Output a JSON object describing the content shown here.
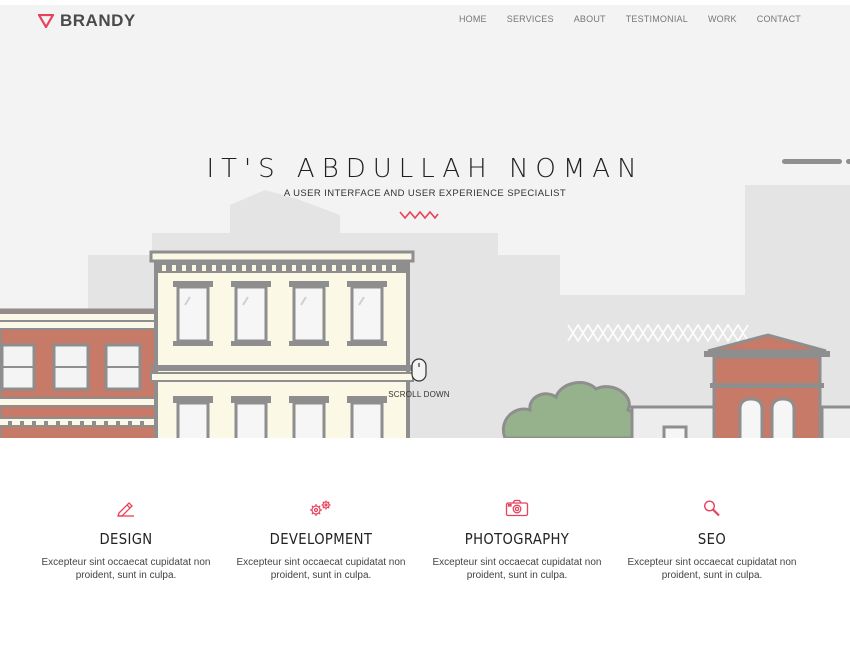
{
  "brand": {
    "name": "BRANDY",
    "accent": "#e8415c"
  },
  "nav": {
    "items": [
      "HOME",
      "SERVICES",
      "ABOUT",
      "TESTIMONIAL",
      "WORK",
      "CONTACT"
    ]
  },
  "hero": {
    "title": "IT'S ABDULLAH NOMAN",
    "subtitle": "A USER INTERFACE AND USER EXPERIENCE SPECIALIST",
    "scroll_label": "SCROLL DOWN"
  },
  "services": [
    {
      "icon": "pencil-icon",
      "title": "DESIGN",
      "text": "Excepteur sint occaecat cupidatat non proident, sunt in culpa."
    },
    {
      "icon": "gears-icon",
      "title": "DEVELOPMENT",
      "text": "Excepteur sint occaecat cupidatat non proident, sunt in culpa."
    },
    {
      "icon": "camera-icon",
      "title": "PHOTOGRAPHY",
      "text": "Excepteur sint occaecat cupidatat non proident, sunt in culpa."
    },
    {
      "icon": "magnifier-icon",
      "title": "SEO",
      "text": "Excepteur sint occaecat cupidatat non proident, sunt in culpa."
    }
  ]
}
